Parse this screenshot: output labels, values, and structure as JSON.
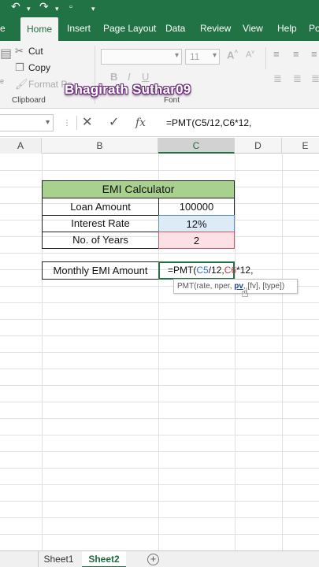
{
  "ribbon": {
    "tabs": [
      "e",
      "Home",
      "Insert",
      "Page Layout",
      "Data",
      "Review",
      "View",
      "Help",
      "Po"
    ],
    "active_tab": "Home",
    "clipboard": {
      "cut": "Cut",
      "copy": "Copy",
      "format_painter": "Format Pa",
      "group_label": "Clipboard"
    },
    "font": {
      "size": "11",
      "group_label": "Font"
    }
  },
  "watermark": "Bhagirath Suthar09",
  "formula_bar": {
    "formula": "=PMT(C5/12,C6*12,"
  },
  "columns": [
    "A",
    "B",
    "C",
    "D",
    "E"
  ],
  "active_column": "C",
  "table": {
    "title": "EMI Calculator",
    "rows": [
      {
        "label": "Loan Amount",
        "value": "100000"
      },
      {
        "label": "Interest Rate",
        "value": "12%"
      },
      {
        "label": "No. of Years",
        "value": "2"
      }
    ],
    "result_label": "Monthly EMI Amount",
    "edit_formula_parts": [
      "=PMT(",
      "C5",
      "/12,",
      "C6",
      "*12,"
    ]
  },
  "tooltip": {
    "prefix": "PMT(rate, nper, ",
    "current_arg": "pv",
    "suffix": ", [fv], [type])"
  },
  "sheets": [
    "Sheet1",
    "Sheet2"
  ],
  "active_sheet": "Sheet2",
  "icons": {
    "undo": "undo-icon",
    "redo": "redo-icon",
    "add_sheet": "plus-icon"
  }
}
